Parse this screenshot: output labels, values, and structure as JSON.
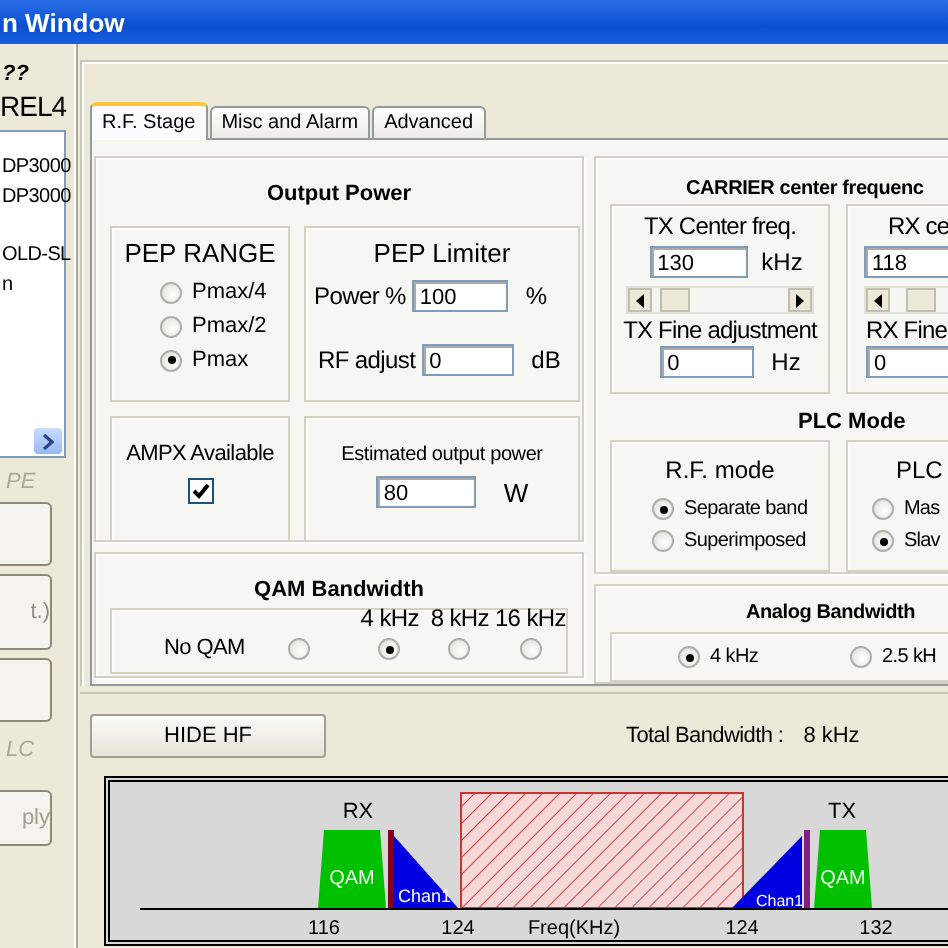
{
  "window": {
    "title": "n Window"
  },
  "sidebar": {
    "header": "??",
    "device": "REL4",
    "items": [
      {
        "label": "DP3000"
      },
      {
        "label": "DP3000"
      },
      {
        "label": "OLD-SL"
      },
      {
        "label": "n"
      }
    ],
    "section_1": "PE",
    "buttons": [
      {
        "kind": "blank"
      },
      {
        "kind": "text",
        "label": "t.)"
      },
      {
        "kind": "blank"
      }
    ],
    "section_2": "LC",
    "apply": {
      "label": "ply",
      "disabled": true
    }
  },
  "tabs": [
    {
      "label": "R.F. Stage",
      "selected": true
    },
    {
      "label": "Misc and Alarm",
      "selected": false
    },
    {
      "label": "Advanced",
      "selected": false
    }
  ],
  "output_power": {
    "title": "Output Power",
    "pep_range": {
      "title": "PEP RANGE",
      "options": [
        {
          "label": "Pmax/4",
          "selected": false
        },
        {
          "label": "Pmax/2",
          "selected": false
        },
        {
          "label": "Pmax",
          "selected": true
        }
      ]
    },
    "pep_limiter": {
      "title": "PEP Limiter",
      "power_label": "Power %",
      "power_value": "100",
      "power_unit": "%",
      "rf_label": "RF adjust",
      "rf_value": "0",
      "rf_unit": "dB"
    },
    "ampx": {
      "label": "AMPX Available",
      "checked": true
    },
    "estimated": {
      "label": "Estimated output power",
      "value": "80",
      "unit": "W"
    }
  },
  "qam_bandwidth": {
    "title": "QAM Bandwidth",
    "options": [
      {
        "kind": "inline",
        "label": "No QAM",
        "selected": false
      },
      {
        "kind": "stacked",
        "label": "4 kHz",
        "selected": true
      },
      {
        "kind": "stacked",
        "label": "8 kHz",
        "selected": false
      },
      {
        "kind": "stacked",
        "label": "16 kHz",
        "selected": false
      }
    ]
  },
  "carrier": {
    "title": "CARRIER center frequenc",
    "tx": {
      "title": "TX Center freq.",
      "value": "130",
      "unit": "kHz",
      "fine_label": "TX Fine adjustment",
      "fine_value": "0",
      "fine_unit": "Hz"
    },
    "rx": {
      "title": "RX ce",
      "value": "118",
      "fine_label": "RX Fine",
      "fine_value": "0"
    }
  },
  "plc_mode": {
    "title": "PLC Mode",
    "rf_mode": {
      "title": "R.F. mode",
      "options": [
        {
          "label": "Separate band",
          "selected": true
        },
        {
          "label": "Superimposed",
          "selected": false
        }
      ]
    },
    "plc": {
      "title": "PLC",
      "options": [
        {
          "label": "Mas",
          "selected": false
        },
        {
          "label": "Slav",
          "selected": true
        }
      ]
    }
  },
  "analog_bandwidth": {
    "title": "Analog Bandwidth",
    "options": [
      {
        "label": "4 kHz",
        "selected": true
      },
      {
        "label": "2.5 kH",
        "selected": false
      }
    ]
  },
  "hide_button": "HIDE HF",
  "total_bandwidth": {
    "label": "Total Bandwidth :",
    "value": "8 kHz"
  },
  "spectrum": {
    "rx_label": "RX",
    "tx_label": "TX",
    "axis_label": "Freq(KHz)",
    "ticks": [
      "116",
      "124",
      "124",
      "132"
    ],
    "bands": [
      {
        "kind": "qam",
        "label": "QAM"
      },
      {
        "kind": "pilot"
      },
      {
        "kind": "channel",
        "label": "Chan1"
      },
      {
        "kind": "guard"
      },
      {
        "kind": "channel",
        "label": "Chan1"
      },
      {
        "kind": "pilot"
      },
      {
        "kind": "qam",
        "label": "QAM"
      }
    ]
  }
}
